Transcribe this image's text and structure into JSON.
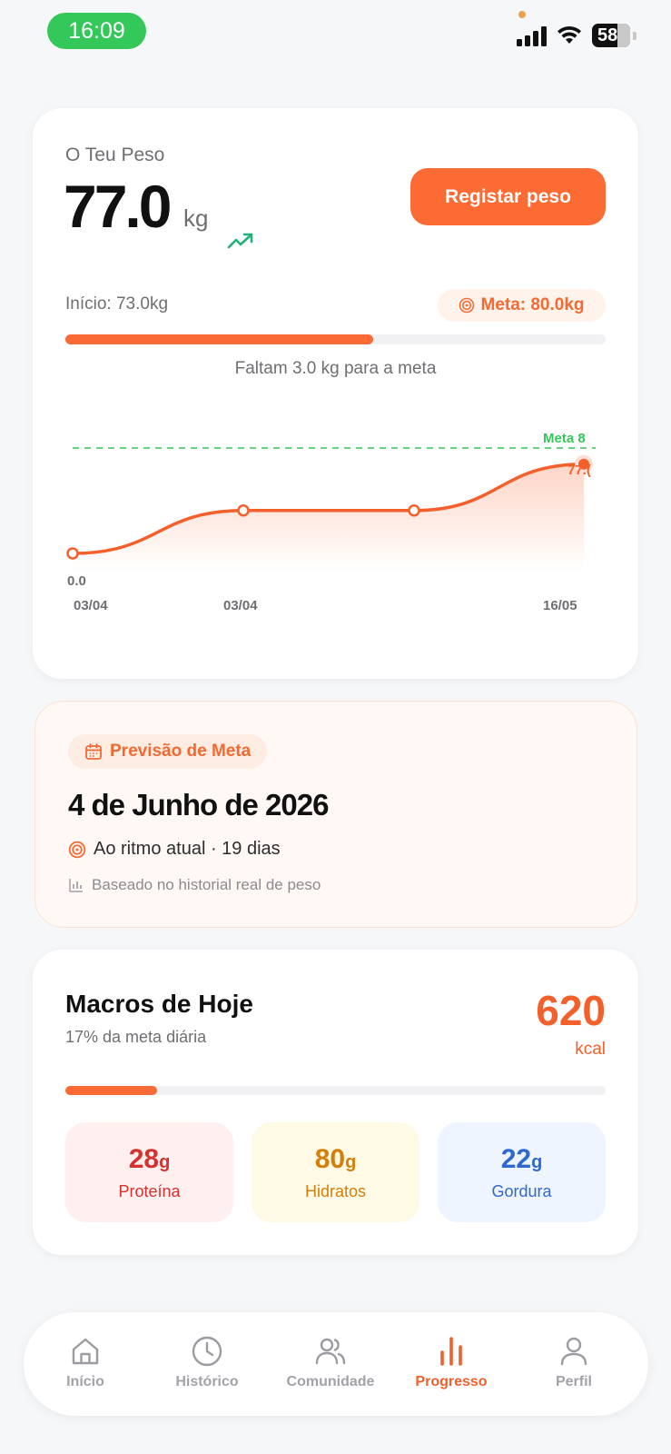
{
  "status_bar": {
    "time": "16:09",
    "battery": "58"
  },
  "weight": {
    "label": "O Teu Peso",
    "value": "77.0",
    "unit": "kg",
    "trend_icon": "trending-up-icon",
    "register_button": "Registar peso",
    "start": "Início: 73.0kg",
    "goal": "Meta: 80.0kg",
    "progress": 0.57,
    "remaining": "Faltam 3.0 kg para a meta",
    "chart": {
      "goal_label": "Meta  8",
      "last_label": "77.(",
      "zero_label": "0.0",
      "x_ticks": [
        "03/04",
        "03/04",
        "16/05"
      ]
    }
  },
  "chart_data": {
    "type": "line",
    "x": [
      "03/04",
      "03/04",
      "",
      "16/05"
    ],
    "values": [
      0.0,
      37,
      37,
      77.0
    ],
    "goal_line": 80.0,
    "grid": false
  },
  "forecast": {
    "badge": "Previsão de Meta",
    "date": "4 de Junho de 2026",
    "pace": "Ao ritmo atual · 19 dias",
    "basis": "Baseado no historial real de peso"
  },
  "macros": {
    "title": "Macros de Hoje",
    "subtitle": "17% da meta diária",
    "kcal": "620",
    "kcal_unit": "kcal",
    "progress": 0.17,
    "items": [
      {
        "value": "28",
        "unit": "g",
        "label": "Proteína",
        "color": "#d3322f",
        "bg": "#fff0f0"
      },
      {
        "value": "80",
        "unit": "g",
        "label": "Hidratos",
        "color": "#d47f0a",
        "bg": "#fffae6"
      },
      {
        "value": "22",
        "unit": "g",
        "label": "Gordura",
        "color": "#2f69cf",
        "bg": "#eef5ff"
      }
    ]
  },
  "nav": [
    {
      "label": "Início",
      "icon": "home-icon"
    },
    {
      "label": "Histórico",
      "icon": "clock-icon"
    },
    {
      "label": "Comunidade",
      "icon": "users-icon"
    },
    {
      "label": "Progresso",
      "icon": "bar-chart-icon",
      "active": true
    },
    {
      "label": "Perfil",
      "icon": "user-icon"
    }
  ],
  "colors": {
    "accent": "#fa6a36",
    "goal_line": "#34c759",
    "trend": "#21b27a"
  }
}
